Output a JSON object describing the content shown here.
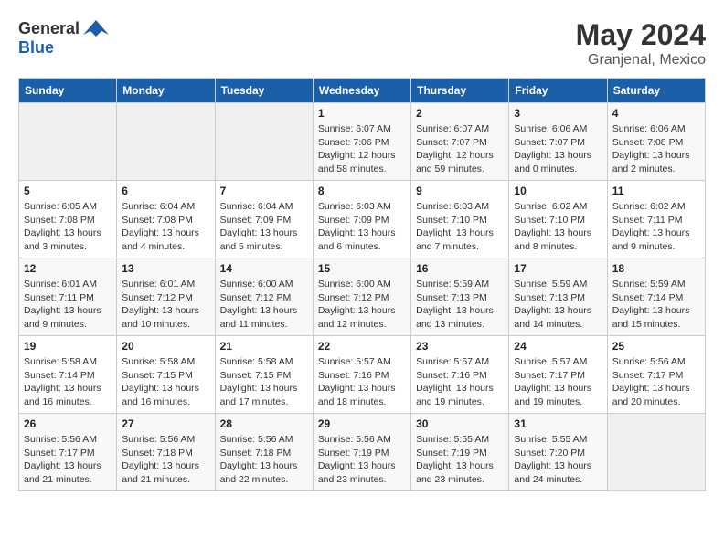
{
  "header": {
    "logo_general": "General",
    "logo_blue": "Blue",
    "month_year": "May 2024",
    "location": "Granjenal, Mexico"
  },
  "weekdays": [
    "Sunday",
    "Monday",
    "Tuesday",
    "Wednesday",
    "Thursday",
    "Friday",
    "Saturday"
  ],
  "weeks": [
    [
      {
        "day": "",
        "sunrise": "",
        "sunset": "",
        "daylight": ""
      },
      {
        "day": "",
        "sunrise": "",
        "sunset": "",
        "daylight": ""
      },
      {
        "day": "",
        "sunrise": "",
        "sunset": "",
        "daylight": ""
      },
      {
        "day": "1",
        "sunrise": "Sunrise: 6:07 AM",
        "sunset": "Sunset: 7:06 PM",
        "daylight": "Daylight: 12 hours and 58 minutes."
      },
      {
        "day": "2",
        "sunrise": "Sunrise: 6:07 AM",
        "sunset": "Sunset: 7:07 PM",
        "daylight": "Daylight: 12 hours and 59 minutes."
      },
      {
        "day": "3",
        "sunrise": "Sunrise: 6:06 AM",
        "sunset": "Sunset: 7:07 PM",
        "daylight": "Daylight: 13 hours and 0 minutes."
      },
      {
        "day": "4",
        "sunrise": "Sunrise: 6:06 AM",
        "sunset": "Sunset: 7:08 PM",
        "daylight": "Daylight: 13 hours and 2 minutes."
      }
    ],
    [
      {
        "day": "5",
        "sunrise": "Sunrise: 6:05 AM",
        "sunset": "Sunset: 7:08 PM",
        "daylight": "Daylight: 13 hours and 3 minutes."
      },
      {
        "day": "6",
        "sunrise": "Sunrise: 6:04 AM",
        "sunset": "Sunset: 7:08 PM",
        "daylight": "Daylight: 13 hours and 4 minutes."
      },
      {
        "day": "7",
        "sunrise": "Sunrise: 6:04 AM",
        "sunset": "Sunset: 7:09 PM",
        "daylight": "Daylight: 13 hours and 5 minutes."
      },
      {
        "day": "8",
        "sunrise": "Sunrise: 6:03 AM",
        "sunset": "Sunset: 7:09 PM",
        "daylight": "Daylight: 13 hours and 6 minutes."
      },
      {
        "day": "9",
        "sunrise": "Sunrise: 6:03 AM",
        "sunset": "Sunset: 7:10 PM",
        "daylight": "Daylight: 13 hours and 7 minutes."
      },
      {
        "day": "10",
        "sunrise": "Sunrise: 6:02 AM",
        "sunset": "Sunset: 7:10 PM",
        "daylight": "Daylight: 13 hours and 8 minutes."
      },
      {
        "day": "11",
        "sunrise": "Sunrise: 6:02 AM",
        "sunset": "Sunset: 7:11 PM",
        "daylight": "Daylight: 13 hours and 9 minutes."
      }
    ],
    [
      {
        "day": "12",
        "sunrise": "Sunrise: 6:01 AM",
        "sunset": "Sunset: 7:11 PM",
        "daylight": "Daylight: 13 hours and 9 minutes."
      },
      {
        "day": "13",
        "sunrise": "Sunrise: 6:01 AM",
        "sunset": "Sunset: 7:12 PM",
        "daylight": "Daylight: 13 hours and 10 minutes."
      },
      {
        "day": "14",
        "sunrise": "Sunrise: 6:00 AM",
        "sunset": "Sunset: 7:12 PM",
        "daylight": "Daylight: 13 hours and 11 minutes."
      },
      {
        "day": "15",
        "sunrise": "Sunrise: 6:00 AM",
        "sunset": "Sunset: 7:12 PM",
        "daylight": "Daylight: 13 hours and 12 minutes."
      },
      {
        "day": "16",
        "sunrise": "Sunrise: 5:59 AM",
        "sunset": "Sunset: 7:13 PM",
        "daylight": "Daylight: 13 hours and 13 minutes."
      },
      {
        "day": "17",
        "sunrise": "Sunrise: 5:59 AM",
        "sunset": "Sunset: 7:13 PM",
        "daylight": "Daylight: 13 hours and 14 minutes."
      },
      {
        "day": "18",
        "sunrise": "Sunrise: 5:59 AM",
        "sunset": "Sunset: 7:14 PM",
        "daylight": "Daylight: 13 hours and 15 minutes."
      }
    ],
    [
      {
        "day": "19",
        "sunrise": "Sunrise: 5:58 AM",
        "sunset": "Sunset: 7:14 PM",
        "daylight": "Daylight: 13 hours and 16 minutes."
      },
      {
        "day": "20",
        "sunrise": "Sunrise: 5:58 AM",
        "sunset": "Sunset: 7:15 PM",
        "daylight": "Daylight: 13 hours and 16 minutes."
      },
      {
        "day": "21",
        "sunrise": "Sunrise: 5:58 AM",
        "sunset": "Sunset: 7:15 PM",
        "daylight": "Daylight: 13 hours and 17 minutes."
      },
      {
        "day": "22",
        "sunrise": "Sunrise: 5:57 AM",
        "sunset": "Sunset: 7:16 PM",
        "daylight": "Daylight: 13 hours and 18 minutes."
      },
      {
        "day": "23",
        "sunrise": "Sunrise: 5:57 AM",
        "sunset": "Sunset: 7:16 PM",
        "daylight": "Daylight: 13 hours and 19 minutes."
      },
      {
        "day": "24",
        "sunrise": "Sunrise: 5:57 AM",
        "sunset": "Sunset: 7:17 PM",
        "daylight": "Daylight: 13 hours and 19 minutes."
      },
      {
        "day": "25",
        "sunrise": "Sunrise: 5:56 AM",
        "sunset": "Sunset: 7:17 PM",
        "daylight": "Daylight: 13 hours and 20 minutes."
      }
    ],
    [
      {
        "day": "26",
        "sunrise": "Sunrise: 5:56 AM",
        "sunset": "Sunset: 7:17 PM",
        "daylight": "Daylight: 13 hours and 21 minutes."
      },
      {
        "day": "27",
        "sunrise": "Sunrise: 5:56 AM",
        "sunset": "Sunset: 7:18 PM",
        "daylight": "Daylight: 13 hours and 21 minutes."
      },
      {
        "day": "28",
        "sunrise": "Sunrise: 5:56 AM",
        "sunset": "Sunset: 7:18 PM",
        "daylight": "Daylight: 13 hours and 22 minutes."
      },
      {
        "day": "29",
        "sunrise": "Sunrise: 5:56 AM",
        "sunset": "Sunset: 7:19 PM",
        "daylight": "Daylight: 13 hours and 23 minutes."
      },
      {
        "day": "30",
        "sunrise": "Sunrise: 5:55 AM",
        "sunset": "Sunset: 7:19 PM",
        "daylight": "Daylight: 13 hours and 23 minutes."
      },
      {
        "day": "31",
        "sunrise": "Sunrise: 5:55 AM",
        "sunset": "Sunset: 7:20 PM",
        "daylight": "Daylight: 13 hours and 24 minutes."
      },
      {
        "day": "",
        "sunrise": "",
        "sunset": "",
        "daylight": ""
      }
    ]
  ]
}
